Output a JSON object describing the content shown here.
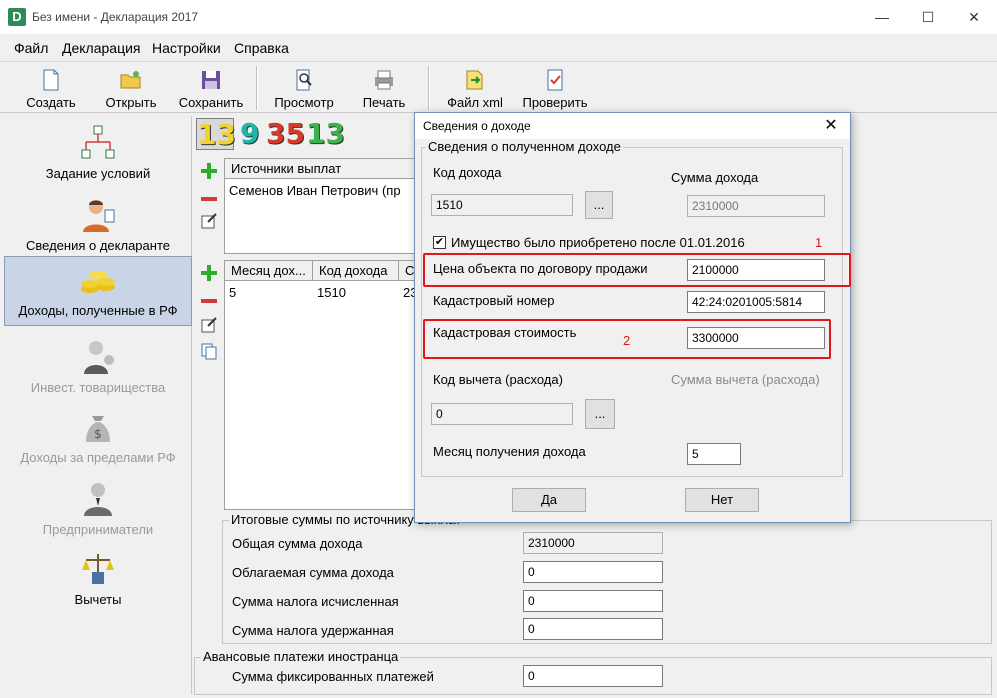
{
  "window": {
    "title": "Без имени - Декларация 2017",
    "app_icon_letter": "D",
    "minimize": "—",
    "maximize": "☐",
    "close": "✕"
  },
  "menu": [
    "Файл",
    "Декларация",
    "Настройки",
    "Справка"
  ],
  "toolbar": {
    "create": "Создать",
    "open": "Открыть",
    "save": "Сохранить",
    "preview": "Просмотр",
    "print": "Печать",
    "file_xml": "Файл xml",
    "check": "Проверить"
  },
  "sidebar": [
    {
      "label": "Задание условий",
      "icon": "tree-icon"
    },
    {
      "label": "Сведения о декларанте",
      "icon": "person-icon"
    },
    {
      "label": "Доходы, полученные в РФ",
      "icon": "coins-icon"
    },
    {
      "label": "Инвест. товарищества",
      "icon": "investor-icon"
    },
    {
      "label": "Доходы за пределами РФ",
      "icon": "money-bag-icon"
    },
    {
      "label": "Предприниматели",
      "icon": "businessman-icon"
    },
    {
      "label": "Вычеты",
      "icon": "scales-icon"
    }
  ],
  "rate_tabs": {
    "colors": {
      "active_13": "#f2d22e",
      "rate_9": "#1fb5a8",
      "rate_35": "#d73a2a",
      "rate_13": "#3bb24a"
    },
    "items": [
      "13",
      "9",
      "35",
      "13"
    ]
  },
  "sources": {
    "header": "Источники выплат",
    "rows": [
      "Семенов Иван Петрович (пр"
    ]
  },
  "income_grid": {
    "headers": [
      "Месяц дох...",
      "Код дохода",
      "С"
    ],
    "rows": [
      [
        "5",
        "1510",
        "23"
      ]
    ]
  },
  "totals": {
    "title": "Итоговые суммы по источнику выплат",
    "total_income_label": "Общая сумма дохода",
    "total_income_value": "2310000",
    "taxable_label": "Облагаемая сумма дохода",
    "taxable_value": "0",
    "tax_calc_label": "Сумма налога исчисленная",
    "tax_calc_value": "0",
    "tax_withheld_label": "Сумма налога удержанная",
    "tax_withheld_value": "0"
  },
  "advance": {
    "title": "Авансовые платежи иностранца",
    "fixed_label": "Сумма фиксированных платежей",
    "fixed_value": "0"
  },
  "dialog": {
    "title": "Сведения о доходе",
    "close": "✕",
    "group_title": "Сведения о полученном доходе",
    "income_code_label": "Код дохода",
    "income_code_value": "1510",
    "browse": "...",
    "income_sum_label": "Сумма дохода",
    "income_sum_value": "2310000",
    "checkbox_label": "Имущество было приобретено после 01.01.2016",
    "checkbox_checked": "✔",
    "annotation_1": "1",
    "price_label": "Цена объекта по договору продажи",
    "price_value": "2100000",
    "cadastral_num_label": "Кадастровый номер",
    "cadastral_num_value": "42:24:0201005:5814",
    "cadastral_cost_label": "Кадастровая стоимость",
    "annotation_2": "2",
    "cadastral_cost_value": "3300000",
    "deduction_code_label": "Код вычета (расхода)",
    "deduction_code_value": "0",
    "deduction_sum_label": "Сумма вычета (расхода)",
    "month_label": "Месяц получения дохода",
    "month_value": "5",
    "yes": "Да",
    "no": "Нет",
    "highlight_color": "#e0181b"
  }
}
